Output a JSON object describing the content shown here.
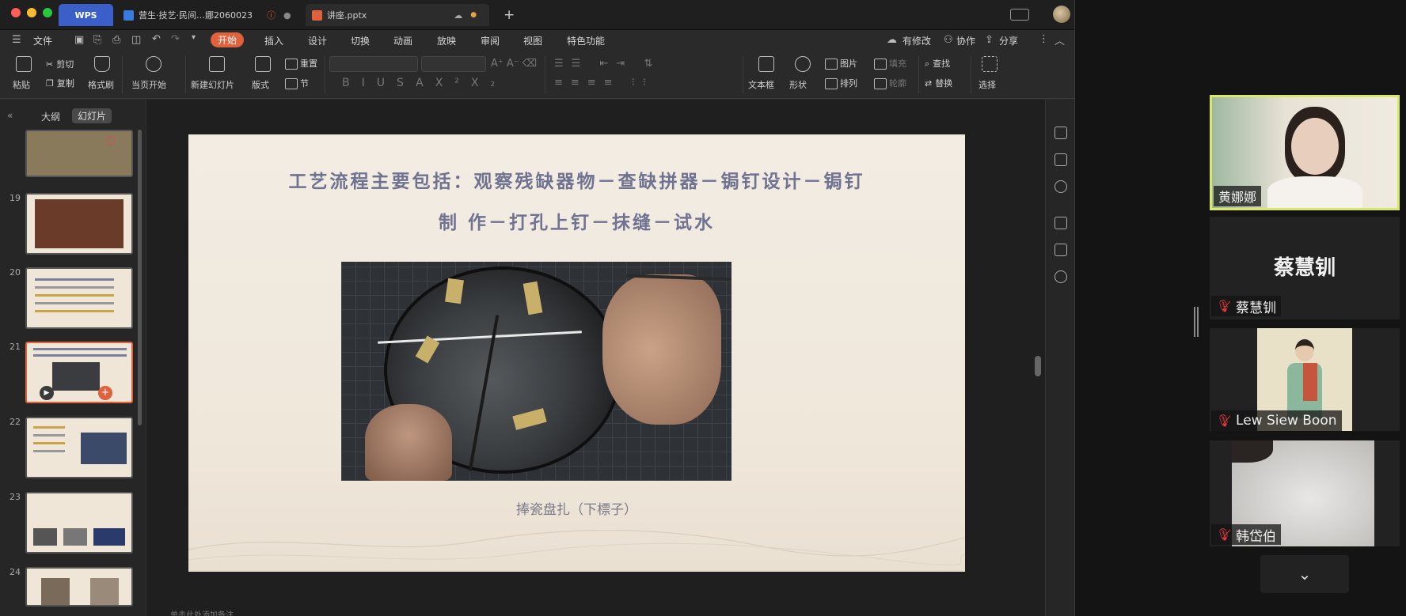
{
  "tabs": {
    "wps": "WPS",
    "doc": "营生·技艺·民间…娜2060023",
    "ppt": "讲座.pptx",
    "add": "+"
  },
  "menu": {
    "file": "文件",
    "items": [
      "开始",
      "插入",
      "设计",
      "切换",
      "动画",
      "放映",
      "审阅",
      "视图",
      "特色功能"
    ],
    "right": [
      "有修改",
      "协作",
      "分享"
    ]
  },
  "ribbon": {
    "paste": "粘贴",
    "cut": "剪切",
    "copy": "复制",
    "format_painter": "格式刷",
    "from_current": "当页开始",
    "new_slide": "新建幻灯片",
    "layout": "版式",
    "reset": "重置",
    "section": "节",
    "textbox": "文本框",
    "shape": "形状",
    "picture": "图片",
    "arrange": "排列",
    "fill": "填充",
    "outline": "轮廓",
    "find": "查找",
    "replace": "替换",
    "select": "选择"
  },
  "panel": {
    "outline_tab": "大纲",
    "slides_tab": "幻灯片",
    "numbers": [
      "19",
      "20",
      "21",
      "22",
      "23",
      "24"
    ]
  },
  "slide": {
    "title_line1": "工艺流程主要包括：观察残缺器物－查缺拼器－锔钉设计－锔钉",
    "title_line2": "制 作－打孔上钉－抹缝－试水",
    "caption": "捧瓷盘扎（下標子）"
  },
  "notes": {
    "placeholder": "单击此处添加备注"
  },
  "participants": [
    {
      "name": "黄娜娜",
      "active": true
    },
    {
      "name": "蔡慧钏",
      "title": "蔡慧钏",
      "muted": true
    },
    {
      "name": "Lew Siew Boon",
      "muted": true
    },
    {
      "name": "韩岱伯",
      "muted": true
    }
  ],
  "colors": {
    "accent": "#e0613b",
    "wps_blue": "#3a5fc8",
    "active_speaker": "#d9e86a",
    "muted": "#e03a3a"
  },
  "icons": {
    "chevron": "chevron-down-icon",
    "muted_mic": "muted-mic-icon"
  }
}
